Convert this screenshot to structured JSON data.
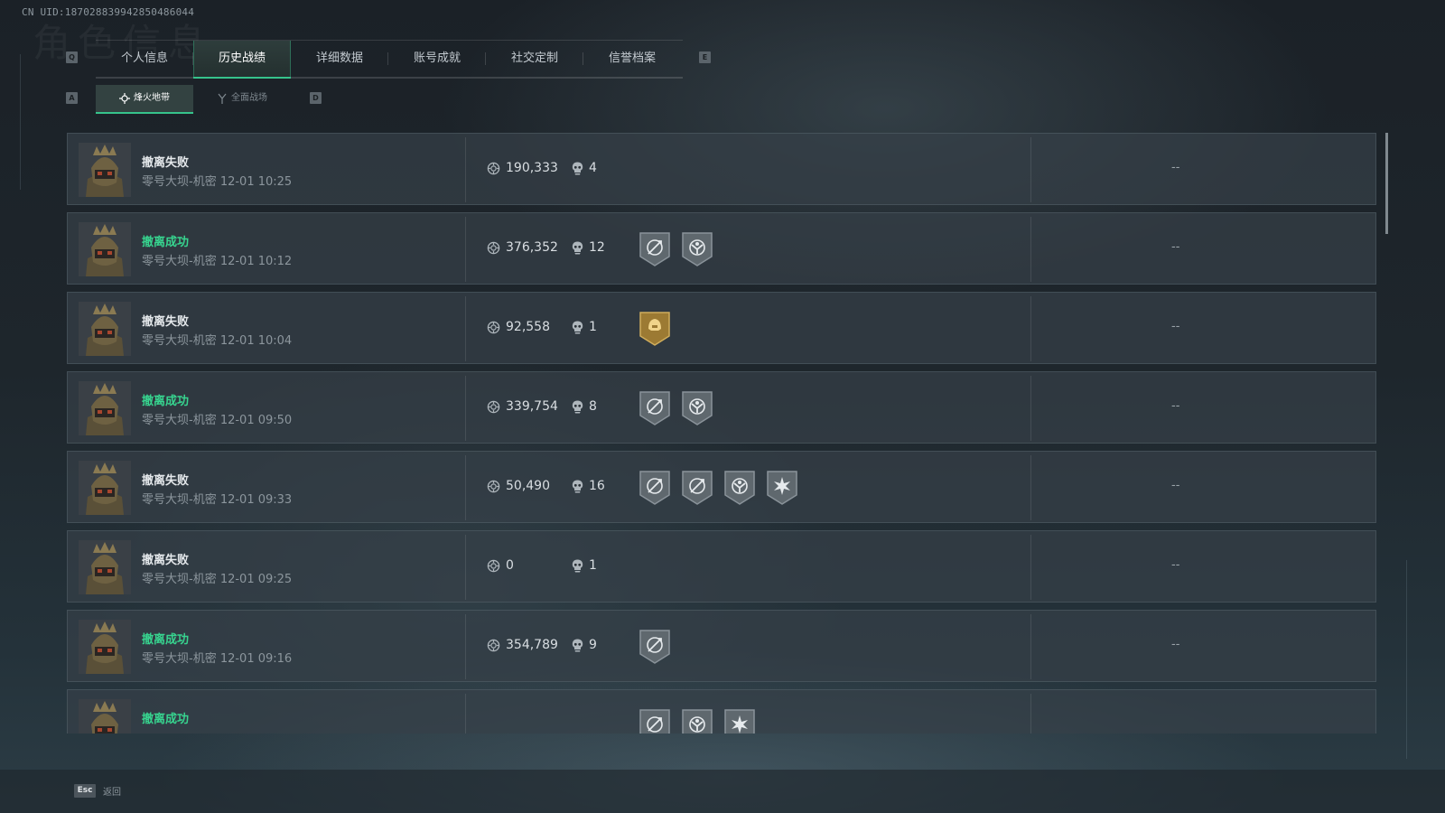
{
  "uid": "CN UID:187028839942850486044",
  "ghost_title": "角色信息",
  "keys": {
    "prev_tab": "Q",
    "next_tab": "E",
    "prev_sub": "A",
    "next_sub": "D"
  },
  "tabs": [
    {
      "label": "个人信息"
    },
    {
      "label": "历史战绩"
    },
    {
      "label": "详细数据"
    },
    {
      "label": "账号成就"
    },
    {
      "label": "社交定制"
    },
    {
      "label": "信誉档案"
    }
  ],
  "active_tab": "历史战绩",
  "subtabs": [
    {
      "label": "烽火地带"
    },
    {
      "label": "全面战场"
    }
  ],
  "colors": {
    "accent": "#36c38b",
    "success": "#37d48f",
    "fail": "#e4e8eb",
    "badge_gold": "#b08a3a",
    "badge_gray": "#6b747a"
  },
  "icons": {
    "money": "currency-icon",
    "kills": "skull-icon"
  },
  "records": [
    {
      "status": "撤离失败",
      "result": "fail",
      "map": "零号大坝-机密 12-01 10:25",
      "money": "190,333",
      "kills": "4",
      "badges": [],
      "extra": "--"
    },
    {
      "status": "撤离成功",
      "result": "success",
      "map": "零号大坝-机密 12-01 10:12",
      "money": "376,352",
      "kills": "12",
      "badges": [
        "gray-plane",
        "gray-eagle"
      ],
      "extra": "--"
    },
    {
      "status": "撤离失败",
      "result": "fail",
      "map": "零号大坝-机密 12-01 10:04",
      "money": "92,558",
      "kills": "1",
      "badges": [
        "gold-helmet"
      ],
      "extra": "--"
    },
    {
      "status": "撤离成功",
      "result": "success",
      "map": "零号大坝-机密 12-01 09:50",
      "money": "339,754",
      "kills": "8",
      "badges": [
        "gray-plane",
        "gray-eagle"
      ],
      "extra": "--"
    },
    {
      "status": "撤离失败",
      "result": "fail",
      "map": "零号大坝-机密 12-01 09:33",
      "money": "50,490",
      "kills": "16",
      "badges": [
        "gray-plane",
        "gray-plane",
        "gray-eagle",
        "gray-burst"
      ],
      "extra": "--"
    },
    {
      "status": "撤离失败",
      "result": "fail",
      "map": "零号大坝-机密 12-01 09:25",
      "money": "0",
      "kills": "1",
      "badges": [],
      "extra": "--"
    },
    {
      "status": "撤离成功",
      "result": "success",
      "map": "零号大坝-机密 12-01 09:16",
      "money": "354,789",
      "kills": "9",
      "badges": [
        "gray-plane"
      ],
      "extra": "--"
    },
    {
      "status": "撤离成功",
      "result": "success",
      "map": "",
      "money": "",
      "kills": "",
      "badges": [
        "gray-plane",
        "gray-eagle",
        "gray-burst"
      ],
      "extra": ""
    }
  ],
  "footer": {
    "esc_key": "Esc",
    "back_label": "返回"
  }
}
